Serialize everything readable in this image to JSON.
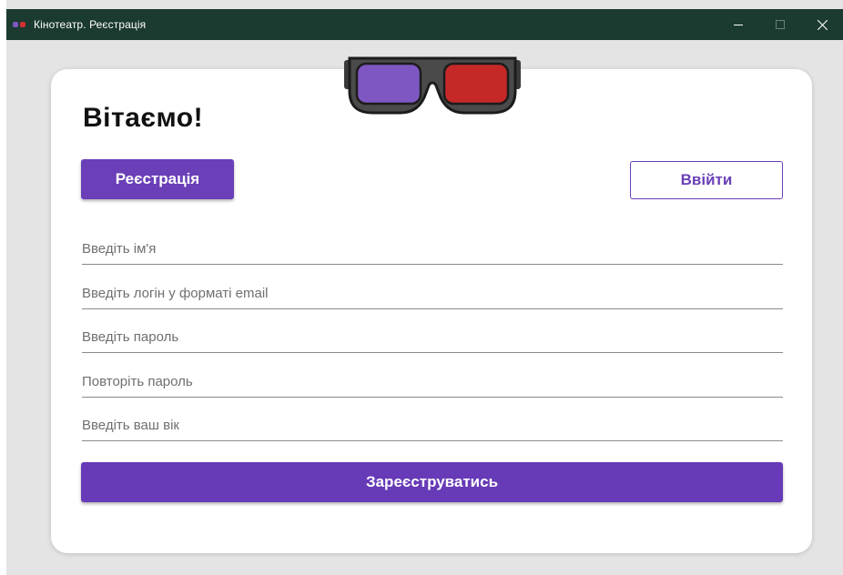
{
  "window": {
    "title": "Кінотеатр. Реєстрація",
    "controls": [
      "minimize",
      "maximize",
      "close"
    ]
  },
  "form": {
    "greeting": "Вітаємо!",
    "tabs": {
      "register_label": "Реєстрація",
      "login_label": "Ввійти"
    },
    "fields": {
      "name_placeholder": "Введіть ім'я",
      "email_placeholder": "Введіть логін у форматі email",
      "password_placeholder": "Введіть пароль",
      "repeat_password_placeholder": "Повторіть пароль",
      "age_placeholder": "Введіть ваш вік"
    },
    "submit_label": "Зареєструватись"
  },
  "icons": {
    "app": "3d-glasses-icon",
    "logo": "3d-glasses-logo"
  },
  "colors": {
    "titlebar": "#1b3a30",
    "accent": "#6a3fb8",
    "lens_left": "#7e57c2",
    "lens_right": "#c62828",
    "background": "#e4e4e4",
    "card": "#ffffff"
  }
}
